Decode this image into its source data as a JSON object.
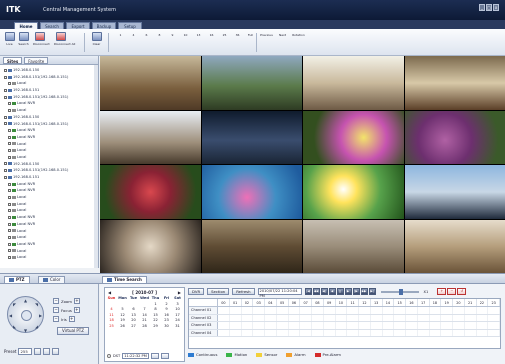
{
  "app": {
    "logo": "ITK",
    "title": "Central Management System"
  },
  "window_buttons": [
    "_",
    "□",
    "x"
  ],
  "tabs": [
    {
      "label": "Home",
      "active": true
    },
    {
      "label": "Search",
      "active": false
    },
    {
      "label": "Export",
      "active": false
    },
    {
      "label": "Backup",
      "active": false
    },
    {
      "label": "Setup",
      "active": false
    }
  ],
  "toolbar": {
    "connect": "Live",
    "search": "Search",
    "disconnect": "Disconnect",
    "disconnect_all": "Disconnect All",
    "clear": "Clear",
    "layouts": [
      "1",
      "4",
      "6",
      "8",
      "9",
      "10",
      "13",
      "16",
      "25",
      "36",
      "Full"
    ],
    "previous": "Previous",
    "next": "Next",
    "rotation": "Rotation"
  },
  "sidebar": {
    "tabs": [
      "Sites",
      "Favorite"
    ],
    "tree": [
      {
        "label": "192.168.0.150",
        "kind": "site"
      },
      {
        "label": "192.168.0.151(192.168.0.151)",
        "kind": "site"
      },
      {
        "label": "Local",
        "kind": "local"
      },
      {
        "label": "192.168.0.151",
        "kind": "site"
      },
      {
        "label": "192.168.0.151(192.168.0.151)",
        "kind": "site"
      },
      {
        "label": "Local NVR",
        "kind": "nvr"
      },
      {
        "label": "Local",
        "kind": "local"
      },
      {
        "label": "192.168.0.150",
        "kind": "site"
      },
      {
        "label": "192.168.0.151(192.168.0.151)",
        "kind": "site"
      },
      {
        "label": "Local NVR",
        "kind": "nvr"
      },
      {
        "label": "Local NVR",
        "kind": "nvr"
      },
      {
        "label": "Local",
        "kind": "local"
      },
      {
        "label": "Local",
        "kind": "local"
      },
      {
        "label": "Local",
        "kind": "local"
      },
      {
        "label": "192.168.0.150",
        "kind": "site"
      },
      {
        "label": "192.168.0.151(192.168.0.151)",
        "kind": "site"
      },
      {
        "label": "192.168.0.151",
        "kind": "site"
      },
      {
        "label": "Local NVR",
        "kind": "nvr"
      },
      {
        "label": "Local NVR",
        "kind": "nvr"
      },
      {
        "label": "Local",
        "kind": "local"
      },
      {
        "label": "Local",
        "kind": "local"
      },
      {
        "label": "Local",
        "kind": "local"
      },
      {
        "label": "Local NVR",
        "kind": "nvr"
      },
      {
        "label": "Local NVR",
        "kind": "nvr"
      },
      {
        "label": "Local",
        "kind": "local"
      },
      {
        "label": "Local",
        "kind": "local"
      },
      {
        "label": "Local NVR",
        "kind": "nvr"
      },
      {
        "label": "Local",
        "kind": "local"
      },
      {
        "label": "Local",
        "kind": "local"
      }
    ]
  },
  "bottom_tabs": {
    "ptz": "PTZ",
    "color": "Color",
    "search": "Time Search"
  },
  "ptz": {
    "zoom": "Zoom",
    "focus": "Focus",
    "iris": "Iris",
    "virtual": "Virtual PTZ",
    "preset_label": "Preset",
    "preset_value": "255"
  },
  "calendar": {
    "month": "[ 2010-07 ]",
    "days_header": [
      "Sun",
      "Mon",
      "Tue",
      "Wed",
      "Thu",
      "Fri",
      "Sat"
    ],
    "days": [
      "",
      "",
      "",
      "",
      "1",
      "2",
      "3",
      "4",
      "5",
      "6",
      "7",
      "8",
      "9",
      "10",
      "11",
      "12",
      "13",
      "14",
      "15",
      "16",
      "17",
      "18",
      "19",
      "20",
      "21",
      "22",
      "23",
      "24",
      "25",
      "26",
      "27",
      "28",
      "29",
      "30",
      "31"
    ],
    "dst": "DST",
    "time": "11:22:32 PM"
  },
  "search_bar": {
    "dvr": "DVR",
    "section": "Section",
    "refresh": "Refresh",
    "datetime": "2010/07/22 11:20:04 PM",
    "zoom_value": "X1"
  },
  "timeline": {
    "hours": [
      "00",
      "01",
      "02",
      "03",
      "04",
      "05",
      "06",
      "07",
      "08",
      "09",
      "10",
      "11",
      "12",
      "13",
      "14",
      "15",
      "16",
      "17",
      "18",
      "19",
      "20",
      "21",
      "22",
      "23"
    ],
    "channels": [
      "Channel 01",
      "Channel 02",
      "Channel 03",
      "Channel 04"
    ]
  },
  "legend": [
    {
      "label": "Continuous",
      "color": "#2e7bd1"
    },
    {
      "label": "Motion",
      "color": "#3bb54a"
    },
    {
      "label": "Sensor",
      "color": "#f2d03b"
    },
    {
      "label": "Alarm",
      "color": "#f0a030"
    },
    {
      "label": "Pre-Alarm",
      "color": "#d42b2b"
    }
  ]
}
